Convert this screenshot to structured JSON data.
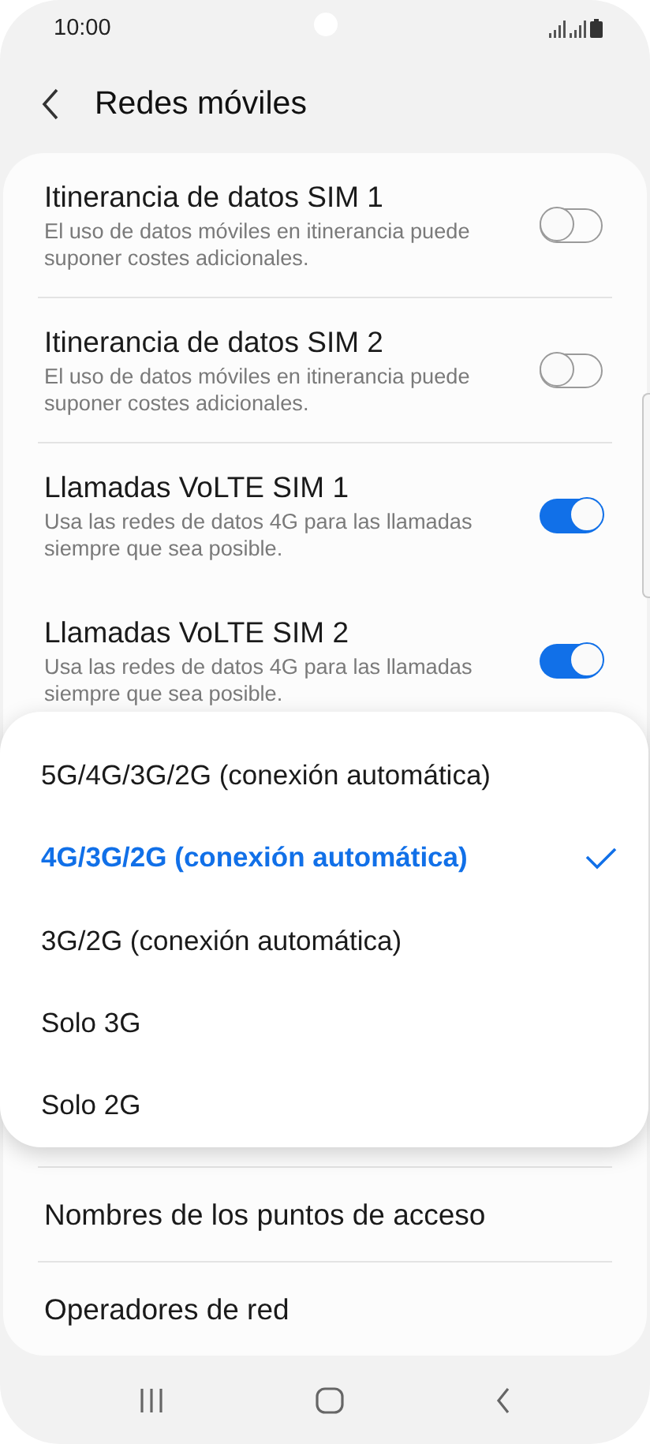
{
  "status_bar": {
    "time": "10:00"
  },
  "header": {
    "title": "Redes móviles"
  },
  "settings": [
    {
      "kind": "toggle",
      "title": "Itinerancia de datos SIM 1",
      "subtitle": "El uso de datos móviles en itinerancia puede suponer costes adicionales.",
      "on": false
    },
    {
      "kind": "toggle",
      "title": "Itinerancia de datos SIM 2",
      "subtitle": "El uso de datos móviles en itinerancia puede suponer costes adicionales.",
      "on": false
    },
    {
      "kind": "toggle",
      "title": "Llamadas VoLTE SIM 1",
      "subtitle": "Usa las redes de datos 4G para las llamadas siempre que sea posible.",
      "on": true
    },
    {
      "kind": "toggle",
      "title": "Llamadas VoLTE SIM 2",
      "subtitle": "Usa las redes de datos 4G para las llamadas siempre que sea posible.",
      "on": true
    }
  ],
  "network_menu": {
    "options": [
      {
        "label": "5G/4G/3G/2G (conexión automática)",
        "selected": false
      },
      {
        "label": "4G/3G/2G (conexión automática)",
        "selected": true
      },
      {
        "label": "3G/2G (conexión automática)",
        "selected": false
      },
      {
        "label": "Solo 3G",
        "selected": false
      },
      {
        "label": "Solo 2G",
        "selected": false
      }
    ]
  },
  "links": [
    {
      "label": "Nombres de los puntos de acceso"
    },
    {
      "label": "Operadores de red"
    }
  ]
}
